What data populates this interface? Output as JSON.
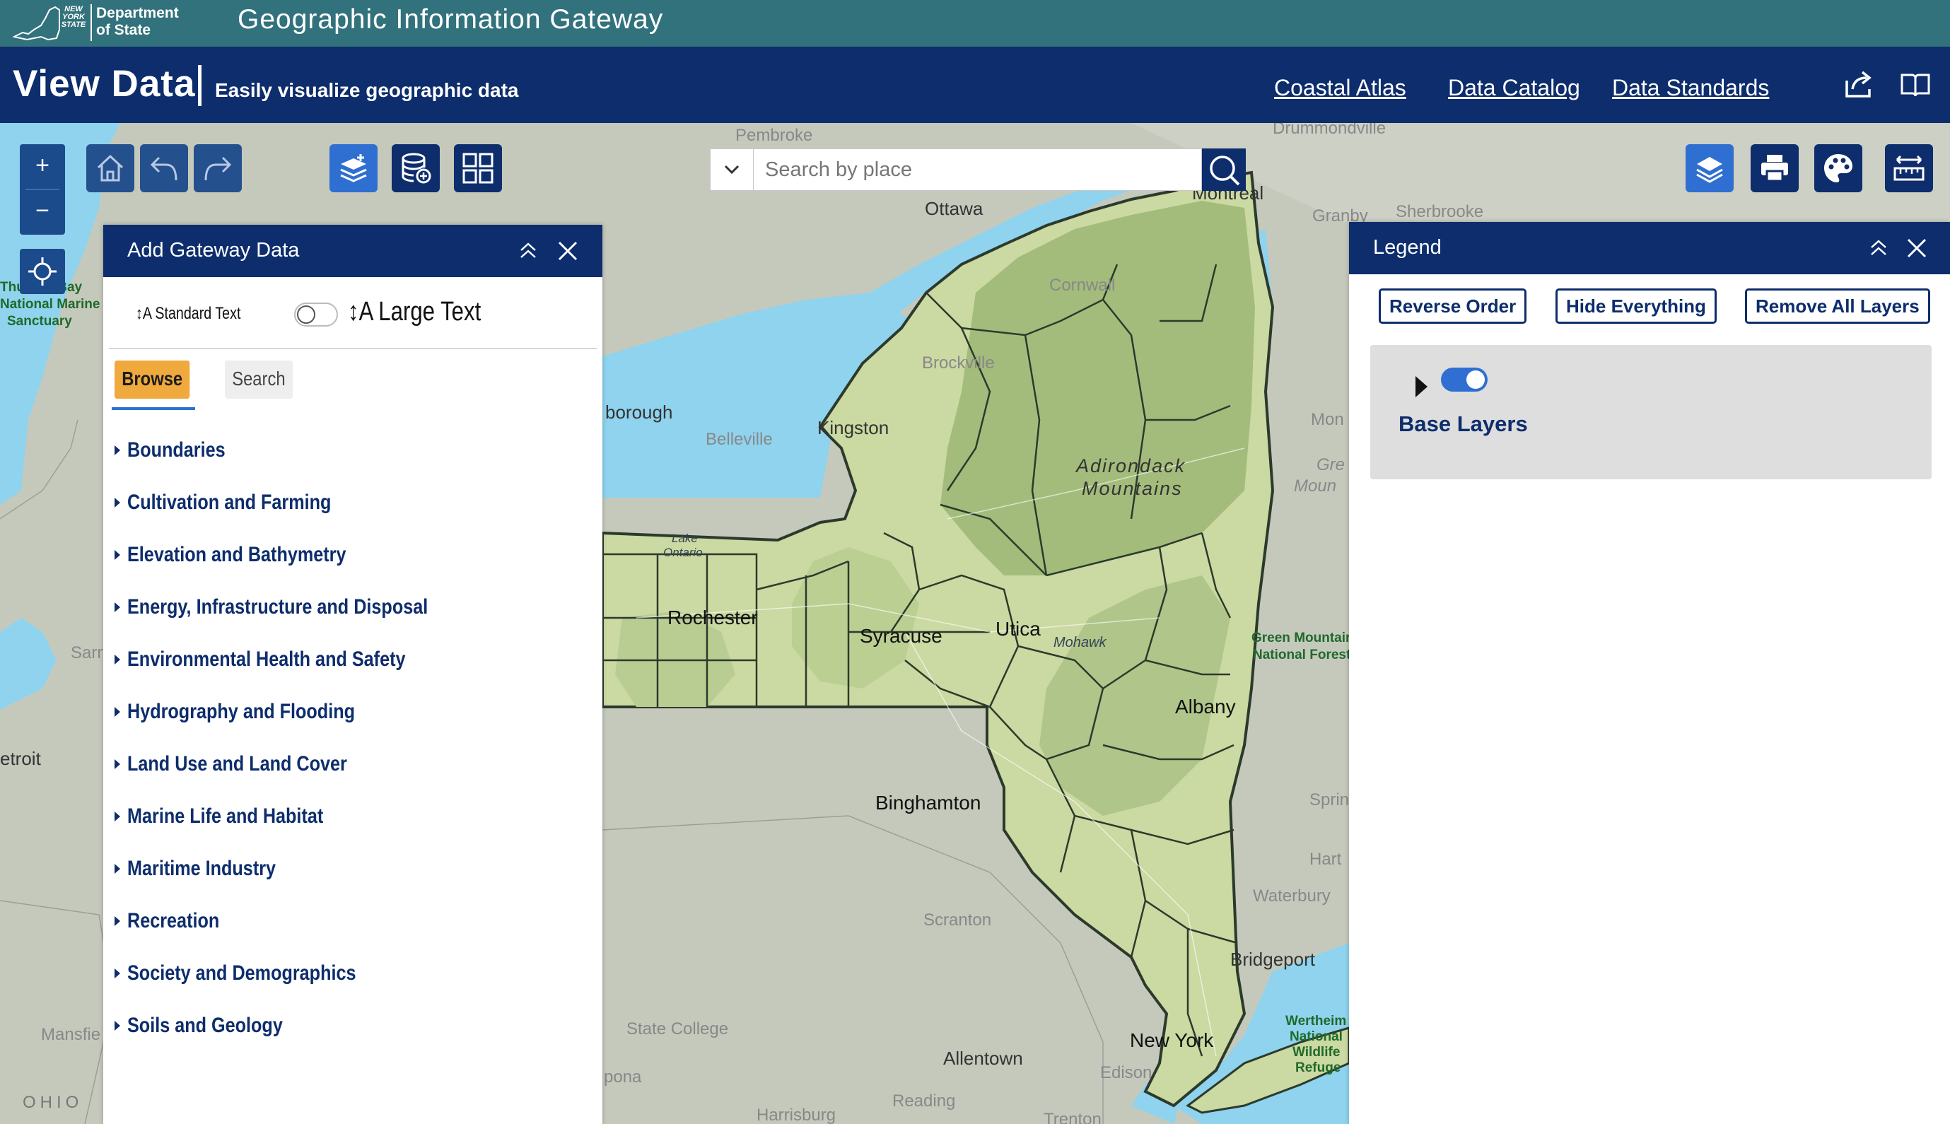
{
  "header": {
    "logo_state": "NEW YORK STATE",
    "logo_dept_line1": "Department",
    "logo_dept_line2": "of State",
    "gateway_title": "Geographic Information Gateway",
    "page_title": "View Data",
    "page_subtitle": "Easily visualize geographic data",
    "nav": [
      "Coastal Atlas",
      "Data Catalog",
      "Data Standards"
    ],
    "icons": [
      "share-icon",
      "book-icon"
    ]
  },
  "map_controls": {
    "zoom_in": "+",
    "zoom_out": "−",
    "search_placeholder": "Search by place",
    "left_tools": [
      "home-icon",
      "undo-icon",
      "redo-icon"
    ],
    "data_tools": [
      "add-layers-icon",
      "add-database-icon",
      "grid-icon"
    ],
    "right_tools": [
      "layers-icon",
      "print-icon",
      "palette-icon",
      "measure-icon"
    ]
  },
  "map_labels": {
    "pembroke": "Pembroke",
    "drummondville": "Drummondville",
    "ottawa": "Ottawa",
    "montreal": "Montreal",
    "granby": "Granby",
    "sherbrooke": "Sherbrooke",
    "cornwall": "Cornwall",
    "brockville": "Brockville",
    "kingston": "Kingston",
    "belleville": "Belleville",
    "borough": "borough",
    "adirondack1": "Adirondack",
    "adirondack2": "Mountains",
    "lake1": "Lake",
    "lake2": "Ontario",
    "rochester": "Rochester",
    "syracuse": "Syracuse",
    "utica": "Utica",
    "mohawk": "Mohawk",
    "albany": "Albany",
    "binghamton": "Binghamton",
    "green_mtn1": "Green Mountain",
    "green_mtn2": "National Forest",
    "mon": "Mon",
    "gre": "Gre",
    "moun": "Moun",
    "sprin": "Sprin",
    "hart": "Hart",
    "waterbury": "Waterbury",
    "scranton": "Scranton",
    "bridgeport": "Bridgeport",
    "new_york": "New York",
    "state_college": "State College",
    "allentown": "Allentown",
    "edison": "Edison",
    "reading": "Reading",
    "harrisburg": "Harrisburg",
    "trenton": "Trenton",
    "pona": "pona",
    "wertheim1": "Wertheim",
    "wertheim2": "National",
    "wertheim3": "Wildlife",
    "wertheim4": "Refuge",
    "thunder1": "Thunder Bay",
    "thunder2": "National Marine",
    "thunder3": "Sanctuary",
    "sarn": "Sarn",
    "etroit": "etroit",
    "mansfie": "Mansfie",
    "ohio": "OHIO"
  },
  "data_panel": {
    "title": "Add Gateway Data",
    "standard_text": "↕A Standard Text",
    "large_text": "↕A Large Text",
    "tabs": [
      "Browse",
      "Search"
    ],
    "categories": [
      "Boundaries",
      "Cultivation and Farming",
      "Elevation and Bathymetry",
      "Energy, Infrastructure and Disposal",
      "Environmental Health and Safety",
      "Hydrography and Flooding",
      "Land Use and Land Cover",
      "Marine Life and Habitat",
      "Maritime Industry",
      "Recreation",
      "Society and Demographics",
      "Soils and Geology"
    ]
  },
  "legend": {
    "title": "Legend",
    "buttons": [
      "Reverse Order",
      "Hide Everything",
      "Remove All Layers"
    ],
    "layer_name": "Base Layers",
    "layer_visible": true
  },
  "colors": {
    "header_teal": "#32727c",
    "header_navy": "#0d2d6c",
    "browse_orange": "#f0a93d",
    "accent_blue": "#2f6fd1",
    "water": "#8fd3ee",
    "ny_land": "#c9d8a0"
  }
}
